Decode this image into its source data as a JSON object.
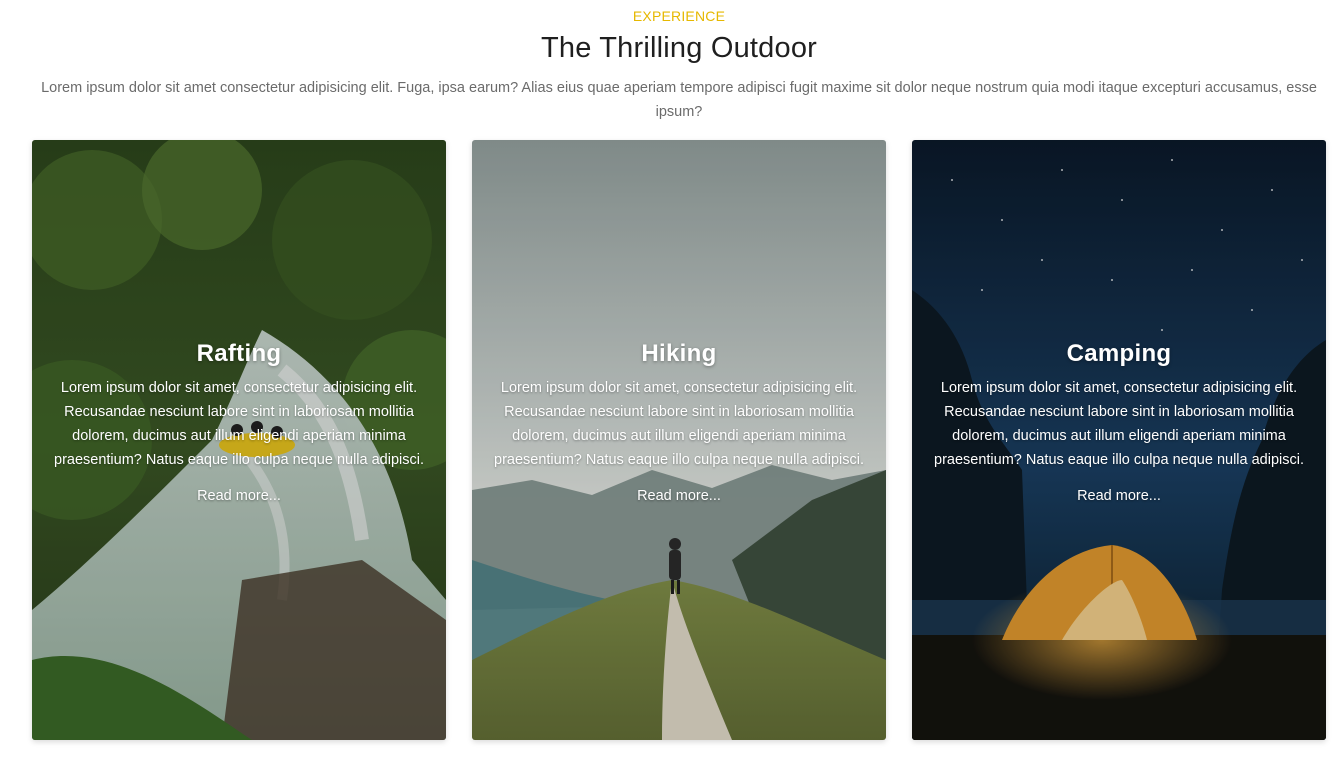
{
  "section": {
    "eyebrow": "EXPERIENCE",
    "title": "The Thrilling Outdoor",
    "lede": "Lorem ipsum dolor sit amet consectetur adipisicing elit. Fuga, ipsa earum? Alias eius quae aperiam tempore adipisci fugit maxime sit dolor neque nostrum quia modi itaque excepturi accusamus, esse ipsum?"
  },
  "colors": {
    "accent": "#e6b800",
    "title": "#1f1f1f",
    "body_text": "#6b6b6b"
  },
  "cards": [
    {
      "title": "Rafting",
      "body": "Lorem ipsum dolor sit amet, consectetur adipisicing elit. Recusandae nesciunt labore sint in laboriosam mollitia dolorem, ducimus aut illum eligendi aperiam minima praesentium? Natus eaque illo culpa neque nulla adipisci.",
      "link": "Read more...",
      "image": "river-rafting-photo"
    },
    {
      "title": "Hiking",
      "body": "Lorem ipsum dolor sit amet, consectetur adipisicing elit. Recusandae nesciunt labore sint in laboriosam mollitia dolorem, ducimus aut illum eligendi aperiam minima praesentium? Natus eaque illo culpa neque nulla adipisci.",
      "link": "Read more...",
      "image": "mountain-trail-hiker-photo"
    },
    {
      "title": "Camping",
      "body": "Lorem ipsum dolor sit amet, consectetur adipisicing elit. Recusandae nesciunt labore sint in laboriosam mollitia dolorem, ducimus aut illum eligendi aperiam minima praesentium? Natus eaque illo culpa neque nulla adipisci.",
      "link": "Read more...",
      "image": "night-tent-camping-photo"
    }
  ]
}
